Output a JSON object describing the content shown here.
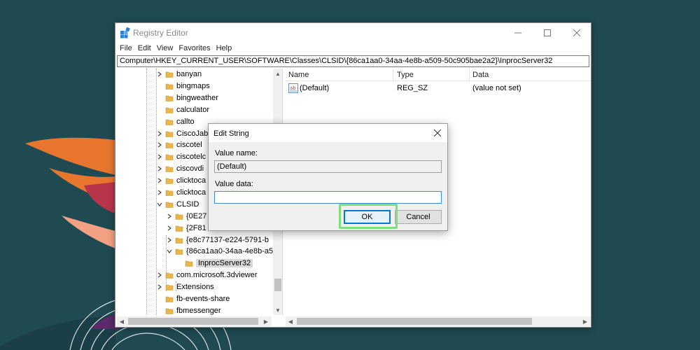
{
  "window": {
    "title": "Registry Editor"
  },
  "menu": [
    "File",
    "Edit",
    "View",
    "Favorites",
    "Help"
  ],
  "address": "Computer\\HKEY_CURRENT_USER\\SOFTWARE\\Classes\\CLSID\\{86ca1aa0-34aa-4e8b-a509-50c905bae2a2}\\InprocServer32",
  "tree": [
    {
      "label": "banyan",
      "expanded": false,
      "has_children": true
    },
    {
      "label": "bingmaps",
      "expanded": false,
      "has_children": false
    },
    {
      "label": "bingweather",
      "expanded": false,
      "has_children": false
    },
    {
      "label": "calculator",
      "expanded": false,
      "has_children": false
    },
    {
      "label": "callto",
      "expanded": false,
      "has_children": false
    },
    {
      "label": "CiscoJab",
      "expanded": false,
      "has_children": true
    },
    {
      "label": "ciscotel",
      "expanded": false,
      "has_children": true
    },
    {
      "label": "ciscotelc",
      "expanded": false,
      "has_children": true
    },
    {
      "label": "ciscovdi",
      "expanded": false,
      "has_children": true
    },
    {
      "label": "clicktoca",
      "expanded": false,
      "has_children": true
    },
    {
      "label": "clicktoca",
      "expanded": false,
      "has_children": true
    },
    {
      "label": "CLSID",
      "expanded": true,
      "has_children": true
    },
    {
      "label": "{0E27",
      "expanded": false,
      "has_children": true
    },
    {
      "label": "{2F81",
      "expanded": false,
      "has_children": true
    },
    {
      "label": "{e8c77137-e224-5791-b",
      "expanded": false,
      "has_children": true
    },
    {
      "label": "{86ca1aa0-34aa-4e8b-a5",
      "expanded": true,
      "has_children": true
    },
    {
      "label": "InprocServer32",
      "expanded": false,
      "has_children": false,
      "selected": true
    },
    {
      "label": "com.microsoft.3dviewer",
      "expanded": false,
      "has_children": true
    },
    {
      "label": "Extensions",
      "expanded": false,
      "has_children": true
    },
    {
      "label": "fb-events-share",
      "expanded": false,
      "has_children": false
    },
    {
      "label": "fbmessenger",
      "expanded": false,
      "has_children": false
    }
  ],
  "list": {
    "columns": {
      "name": "Name",
      "type": "Type",
      "data": "Data"
    },
    "rows": [
      {
        "name": "(Default)",
        "type": "REG_SZ",
        "data": "(value not set)",
        "icon": "string-value-icon"
      }
    ]
  },
  "dialog": {
    "title": "Edit String",
    "value_name_label": "Value name:",
    "value_name": "(Default)",
    "value_data_label": "Value data:",
    "value_data": "",
    "ok_label": "OK",
    "cancel_label": "Cancel"
  },
  "colors": {
    "desktop": "#1f4a52",
    "folder": "#e8b64a",
    "accent": "#0078d7",
    "highlight": "#7ee07a"
  }
}
